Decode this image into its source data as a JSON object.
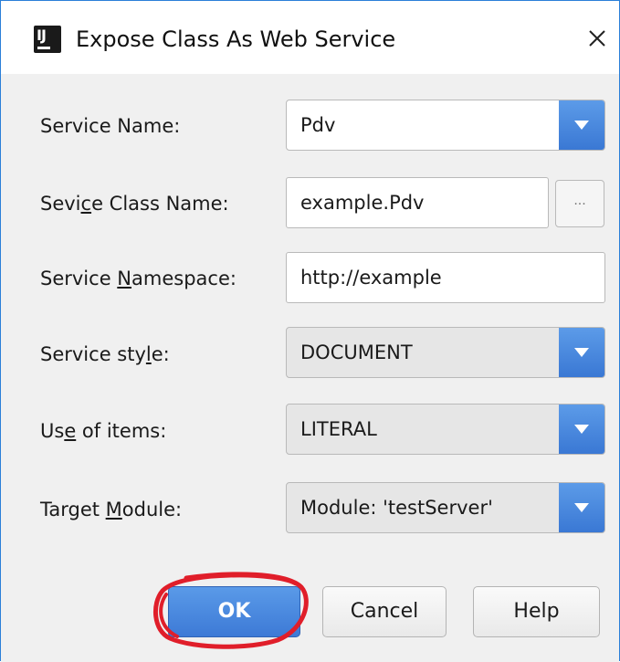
{
  "window": {
    "title": "Expose Class As Web Service",
    "icon": "intellij-idea-icon",
    "close_icon": "close-icon"
  },
  "form": {
    "service_name": {
      "label": {
        "pre": "Service Name:",
        "u": "",
        "post": ""
      },
      "value": "Pdv"
    },
    "service_class_name": {
      "label": {
        "pre": "Sevi",
        "u": "c",
        "post": "e Class Name:"
      },
      "value": "example.Pdv",
      "browse_label": "..."
    },
    "service_namespace": {
      "label": {
        "pre": "Service ",
        "u": "N",
        "post": "amespace:"
      },
      "value": "http://example"
    },
    "service_style": {
      "label": {
        "pre": "Service sty",
        "u": "l",
        "post": "e:"
      },
      "value": "DOCUMENT"
    },
    "use_of_items": {
      "label": {
        "pre": "Us",
        "u": "e",
        "post": " of items:"
      },
      "value": "LITERAL"
    },
    "target_module": {
      "label": {
        "pre": "Target ",
        "u": "M",
        "post": "odule:"
      },
      "value": "Module: 'testServer'"
    }
  },
  "buttons": {
    "ok": "OK",
    "cancel": "Cancel",
    "help": "Help"
  },
  "colors": {
    "accent": "#3d7ad6",
    "annotation": "#e01e2a"
  }
}
